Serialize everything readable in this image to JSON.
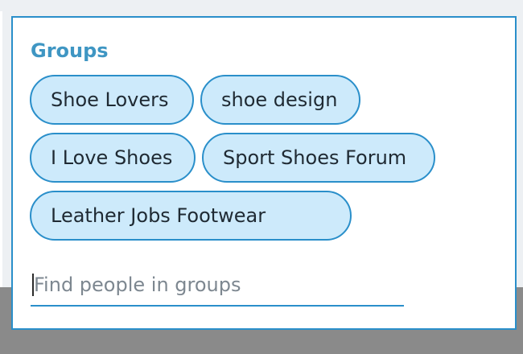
{
  "groups": {
    "heading": "Groups",
    "chips": [
      "Shoe Lovers",
      "shoe design",
      "I Love Shoes",
      "Sport Shoes Forum",
      "Leather Jobs Footwear"
    ]
  },
  "search": {
    "value": "",
    "placeholder": "Find people in groups"
  },
  "colors": {
    "accent": "#2a8fca",
    "heading": "#3f96c3",
    "chip_fill": "#cdeafb"
  }
}
